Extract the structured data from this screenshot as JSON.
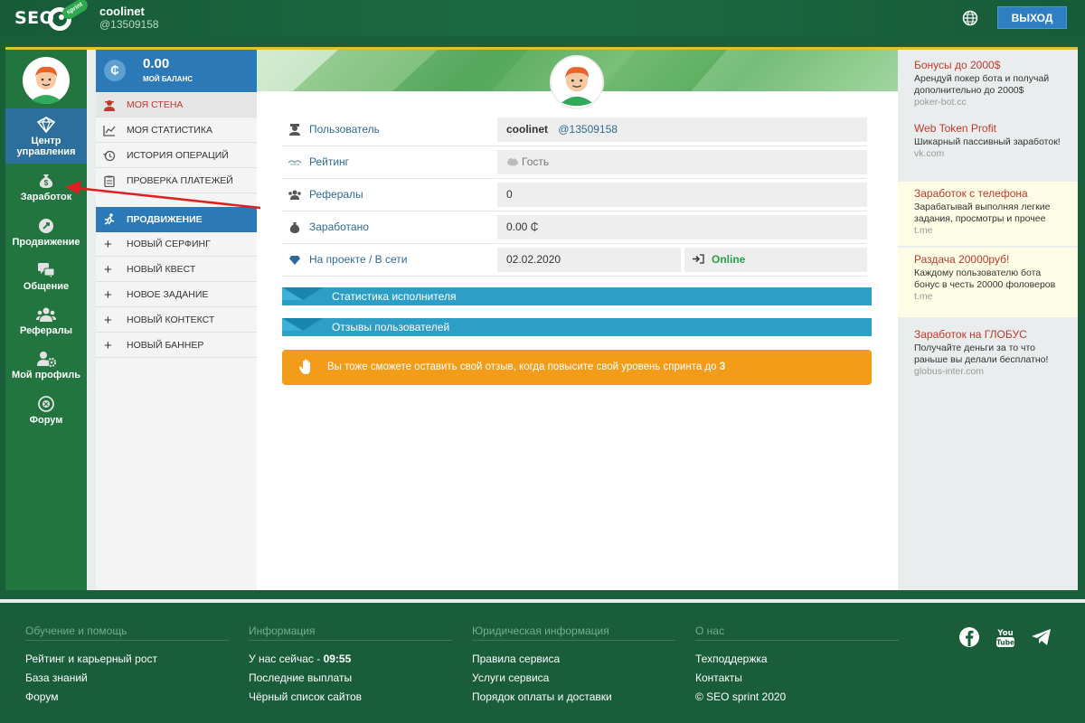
{
  "header": {
    "logo_text": "SEO",
    "logo_badge": "sprint",
    "username": "coolinet",
    "user_id": "@13509158",
    "logout_label": "ВЫХОД"
  },
  "left_sidebar": {
    "items": [
      {
        "label": "Центр управления",
        "icon": "dashboard-icon",
        "active": true
      },
      {
        "label": "Заработок",
        "icon": "money-bag-icon"
      },
      {
        "label": "Продвижение",
        "icon": "rocket-icon"
      },
      {
        "label": "Общение",
        "icon": "chat-icon"
      },
      {
        "label": "Рефералы",
        "icon": "users-icon"
      },
      {
        "label": "Мой профиль",
        "icon": "profile-gear-icon"
      },
      {
        "label": "Форум",
        "icon": "forum-icon"
      }
    ]
  },
  "balance": {
    "coin": "₵",
    "value": "0.00",
    "label": "МОЙ БАЛАНС"
  },
  "menu": {
    "items": [
      {
        "label": "Моя стена",
        "icon": "wall-icon"
      },
      {
        "label": "Моя статистика",
        "icon": "chart-icon"
      },
      {
        "label": "История операций",
        "icon": "history-icon"
      },
      {
        "label": "Проверка платежей",
        "icon": "clipboard-icon"
      }
    ],
    "promo_label": "Продвижение",
    "promo_items": [
      {
        "label": "Новый серфинг"
      },
      {
        "label": "Новый квест"
      },
      {
        "label": "Новое задание"
      },
      {
        "label": "Новый контекст"
      },
      {
        "label": "Новый баннер"
      }
    ]
  },
  "profile": {
    "rows": [
      {
        "label": "Пользователь",
        "icon": "user-icon"
      },
      {
        "label": "Рейтинг",
        "icon": "rating-icon"
      },
      {
        "label": "Рефералы",
        "icon": "referrals-icon"
      },
      {
        "label": "Заработано",
        "icon": "earned-icon"
      },
      {
        "label": "На проекте / В сети",
        "icon": "diamond-icon"
      }
    ],
    "username": "coolinet",
    "user_id": "@13509158",
    "rating": "Гость",
    "referrals": "0",
    "earned": "0.00 ₵",
    "joined": "02.02.2020",
    "online": "Online"
  },
  "accordions": {
    "stats": "Статистика исполнителя",
    "reviews": "Отзывы пользователей"
  },
  "notice": {
    "text": "Вы тоже сможете оставить свой отзыв, когда повысите свой уровень спринта до",
    "level": "3"
  },
  "ads": [
    {
      "title": "Бонусы до 2000$",
      "text": "Арендуй покер бота и получай дополнительно до 2000$",
      "url": "poker-bot.cc"
    },
    {
      "title": "Web Token Profit",
      "text": "Шикарный пассивный заработок!",
      "url": "vk.com"
    },
    {
      "title": "Заработок с телефона",
      "text": "Зарабатывай выполняя легкие задания, просмотры и прочее",
      "url": "t.me"
    },
    {
      "title": "Раздача 20000руб!",
      "text": "Каждому пользователю бота бонус в честь 20000 фоловеров",
      "url": "t.me"
    },
    {
      "title": "Заработок на ГЛОБУС",
      "text": "Получайте деньги за то что раньше вы делали бесплатно!",
      "url": "globus-inter.com"
    }
  ],
  "footer": {
    "columns": [
      {
        "heading": "Обучение и помощь",
        "links": [
          "Рейтинг и карьерный рост",
          "База знаний",
          "Форум"
        ]
      },
      {
        "heading": "Информация",
        "now_label": "У нас сейчас - ",
        "now_time": "09:55",
        "links": [
          "Последние выплаты",
          "Чёрный список сайтов"
        ]
      },
      {
        "heading": "Юридическая информация",
        "links": [
          "Правила сервиса",
          "Услуги сервиса",
          "Порядок оплаты и доставки"
        ]
      },
      {
        "heading": "О нас",
        "links": [
          "Техподдержка",
          "Контакты",
          "© SEO sprint 2020"
        ]
      }
    ],
    "social": [
      "facebook-icon",
      "youtube-icon",
      "telegram-icon"
    ],
    "youtube_text": "You Tube"
  }
}
